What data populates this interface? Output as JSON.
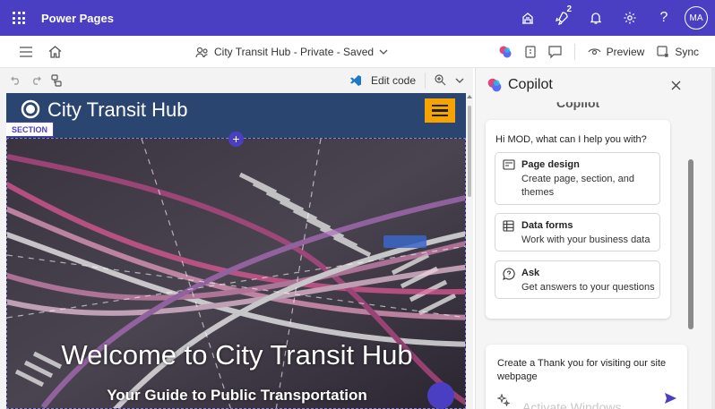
{
  "app": {
    "name": "Power Pages"
  },
  "topbar": {
    "notification_count": "2",
    "avatar_initials": "MA"
  },
  "command_bar": {
    "site_title": "City Transit Hub - Private - Saved",
    "preview_label": "Preview",
    "sync_label": "Sync"
  },
  "editor": {
    "edit_code_label": "Edit code"
  },
  "site": {
    "header_title": "City Transit Hub",
    "section_label": "SECTION",
    "hero_title": "Welcome to City Transit Hub",
    "hero_subtitle": "Your Guide to Public Transportation"
  },
  "copilot": {
    "title": "Copilot",
    "behind_heading": "Copilot",
    "greeting": "Hi MOD, what can I help you with?",
    "options": [
      {
        "title": "Page design",
        "description": "Create page, section, and themes"
      },
      {
        "title": "Data forms",
        "description": "Work with your business data"
      },
      {
        "title": "Ask",
        "description": "Get answers to your questions"
      }
    ],
    "input_text": "Create a Thank you for visiting our site webpage",
    "watermark": "Activate Windows"
  },
  "colors": {
    "brand": "#4a3fc3",
    "site_header": "#2a4670",
    "menu_button": "#f4a300"
  }
}
